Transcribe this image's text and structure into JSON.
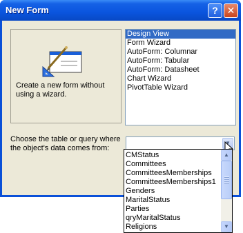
{
  "window": {
    "title": "New Form"
  },
  "titlebar": {
    "help_label": "?",
    "close_label": "✕"
  },
  "description": {
    "text": "Create a new form without using a wizard."
  },
  "views": {
    "items": [
      "Design View",
      "Form Wizard",
      "AutoForm: Columnar",
      "AutoForm: Tabular",
      "AutoForm: Datasheet",
      "Chart Wizard",
      "PivotTable Wizard"
    ],
    "selected": "Design View"
  },
  "source": {
    "label": "Choose the table or query where the object's data comes from:",
    "value": "",
    "options": [
      "CMStatus",
      "Committees",
      "CommitteesMemberships",
      "CommitteesMemberships1",
      "Genders",
      "MaritalStatus",
      "Parties",
      "qryMaritalStatus",
      "Religions"
    ]
  },
  "icons": {
    "dropdown_arrow": "chevron-down-icon",
    "scroll_up": "chevron-up-icon",
    "scroll_down": "chevron-down-icon"
  },
  "colors": {
    "titlebar": "#0a55de",
    "selection": "#316ac5",
    "dialog_bg": "#ece9d8",
    "close_button": "#c8431c"
  }
}
